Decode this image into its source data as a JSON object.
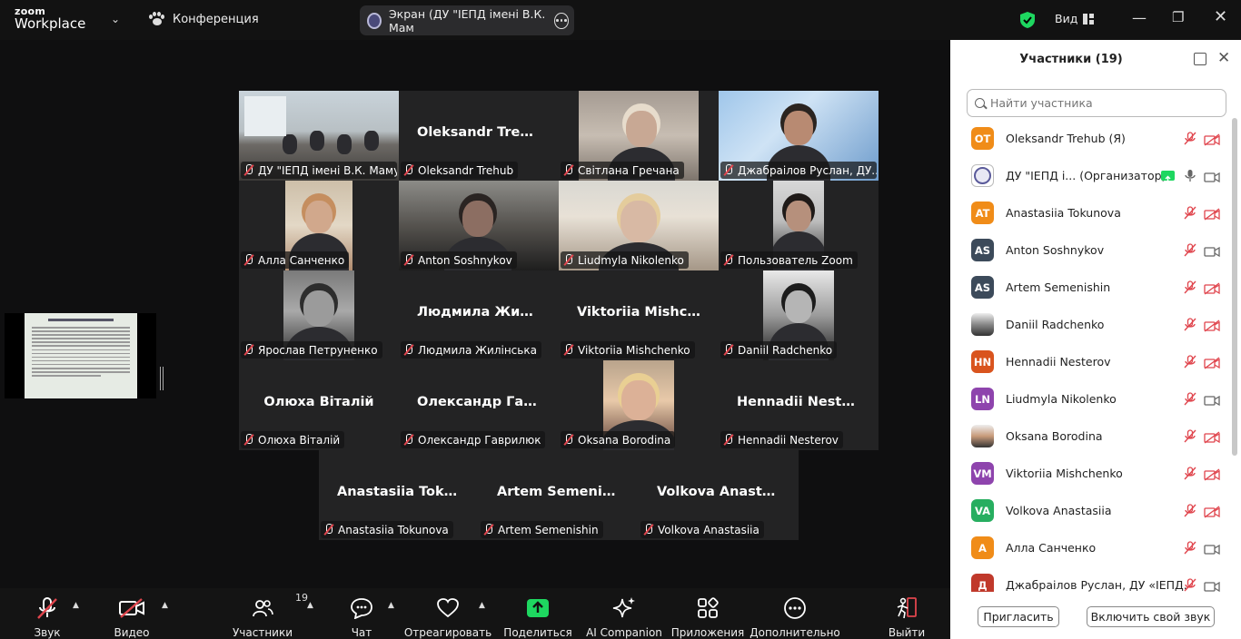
{
  "topbar": {
    "logo_line1": "zoom",
    "logo_line2": "Workplace",
    "meeting_label": "Конференция",
    "share_pill_text": "Экран (ДУ \"ІЕПД імені В.К. Мам",
    "view_label": "Вид",
    "accent_green": "#1ed760"
  },
  "tiles": [
    {
      "id": "t1",
      "big": "",
      "tag": "ДУ \"ІЕПД імені В.К. Мамут...",
      "video": "room"
    },
    {
      "id": "t2",
      "big": "Oleksandr Trehub",
      "tag": "Oleksandr Trehub",
      "video": ""
    },
    {
      "id": "t3",
      "big": "",
      "tag": "Світлана Гречана",
      "video": "person-light"
    },
    {
      "id": "t4",
      "big": "",
      "tag": "Джабраілов Руслан, ДУ...",
      "video": "person-blue"
    },
    {
      "id": "t5",
      "big": "",
      "tag": "Алла Санченко",
      "video": "person-warm"
    },
    {
      "id": "t6",
      "big": "",
      "tag": "Anton Soshnykov",
      "video": "person-dark"
    },
    {
      "id": "t7",
      "big": "",
      "tag": "Liudmyla Nikolenko",
      "video": "person-blonde"
    },
    {
      "id": "t8",
      "big": "",
      "tag": "Пользователь Zoom",
      "video": "person-man"
    },
    {
      "id": "t9",
      "big": "",
      "tag": "Ярослав Петруненко",
      "video": "person-bw"
    },
    {
      "id": "t10",
      "big": "Людмила  Жилі...",
      "tag": "Людмила Жилінська",
      "video": ""
    },
    {
      "id": "t11",
      "big": "Viktoriia  Mishch...",
      "tag": "Viktoriia Mishchenko",
      "video": ""
    },
    {
      "id": "t12",
      "big": "",
      "tag": "Daniil Radchenko",
      "video": "person-bw2"
    },
    {
      "id": "t13",
      "big": "Олюха Віталій",
      "tag": "Олюха Віталій",
      "video": ""
    },
    {
      "id": "t14",
      "big": "Олександр  Гав...",
      "tag": "Олександр Гаврилюк",
      "video": ""
    },
    {
      "id": "t15",
      "big": "",
      "tag": "Oksana Borodina",
      "video": "person-oksana"
    },
    {
      "id": "t16",
      "big": "Hennadii  Nester...",
      "tag": "Hennadii Nesterov",
      "video": ""
    },
    {
      "id": "t17",
      "big": "Anastasiia  Toku...",
      "tag": "Anastasiia Tokunova",
      "video": ""
    },
    {
      "id": "t18",
      "big": "Artem Semenishin",
      "tag": "Artem Semenishin",
      "video": ""
    },
    {
      "id": "t19",
      "big": "Volkova  Anastas...",
      "tag": "Volkova Anastasiia",
      "video": ""
    }
  ],
  "toolbar": {
    "audio": "Звук",
    "video": "Видео",
    "participants": "Участники",
    "participants_count": "19",
    "chat": "Чат",
    "react": "Отреагировать",
    "share": "Поделиться",
    "ai": "AI Companion",
    "apps": "Приложения",
    "more": "Дополнительно",
    "leave": "Выйти"
  },
  "panel": {
    "title": "Участники (19)",
    "search_placeholder": "Найти участника",
    "invite": "Пригласить",
    "unmute_me": "Включить свой звук",
    "participants": [
      {
        "initials": "OT",
        "name": "Oleksandr Trehub (Я)",
        "color": "#f08c18",
        "cam": "off"
      },
      {
        "initials": "",
        "name": "ДУ \"ІЕПД і...    (Организатор)",
        "color": "#ffffff",
        "cam": "on",
        "host": true
      },
      {
        "initials": "AT",
        "name": "Anastasiia Tokunova",
        "color": "#f08c18",
        "cam": "off"
      },
      {
        "initials": "AS",
        "name": "Anton Soshnykov",
        "color": "#3c4a5a",
        "cam": "on"
      },
      {
        "initials": "AS",
        "name": "Artem Semenishin",
        "color": "#3c4a5a",
        "cam": "off"
      },
      {
        "initials": "",
        "name": "Daniil Radchenko",
        "color": "#888888",
        "cam": "off",
        "photo": true
      },
      {
        "initials": "HN",
        "name": "Hennadii Nesterov",
        "color": "#d9541e",
        "cam": "off"
      },
      {
        "initials": "LN",
        "name": "Liudmyla Nikolenko",
        "color": "#8e44ad",
        "cam": "on"
      },
      {
        "initials": "",
        "name": "Oksana Borodina",
        "color": "#c89a7a",
        "cam": "off",
        "photo": true
      },
      {
        "initials": "VM",
        "name": "Viktoriia Mishchenko",
        "color": "#8e44ad",
        "cam": "off"
      },
      {
        "initials": "VA",
        "name": "Volkova Anastasiia",
        "color": "#27ae60",
        "cam": "off"
      },
      {
        "initials": "А",
        "name": "Алла Санченко",
        "color": "#f08c18",
        "cam": "on"
      },
      {
        "initials": "Д",
        "name": "Джабраілов Руслан, ДУ «ІЕПД...",
        "color": "#c0392b",
        "cam": "on"
      }
    ]
  }
}
